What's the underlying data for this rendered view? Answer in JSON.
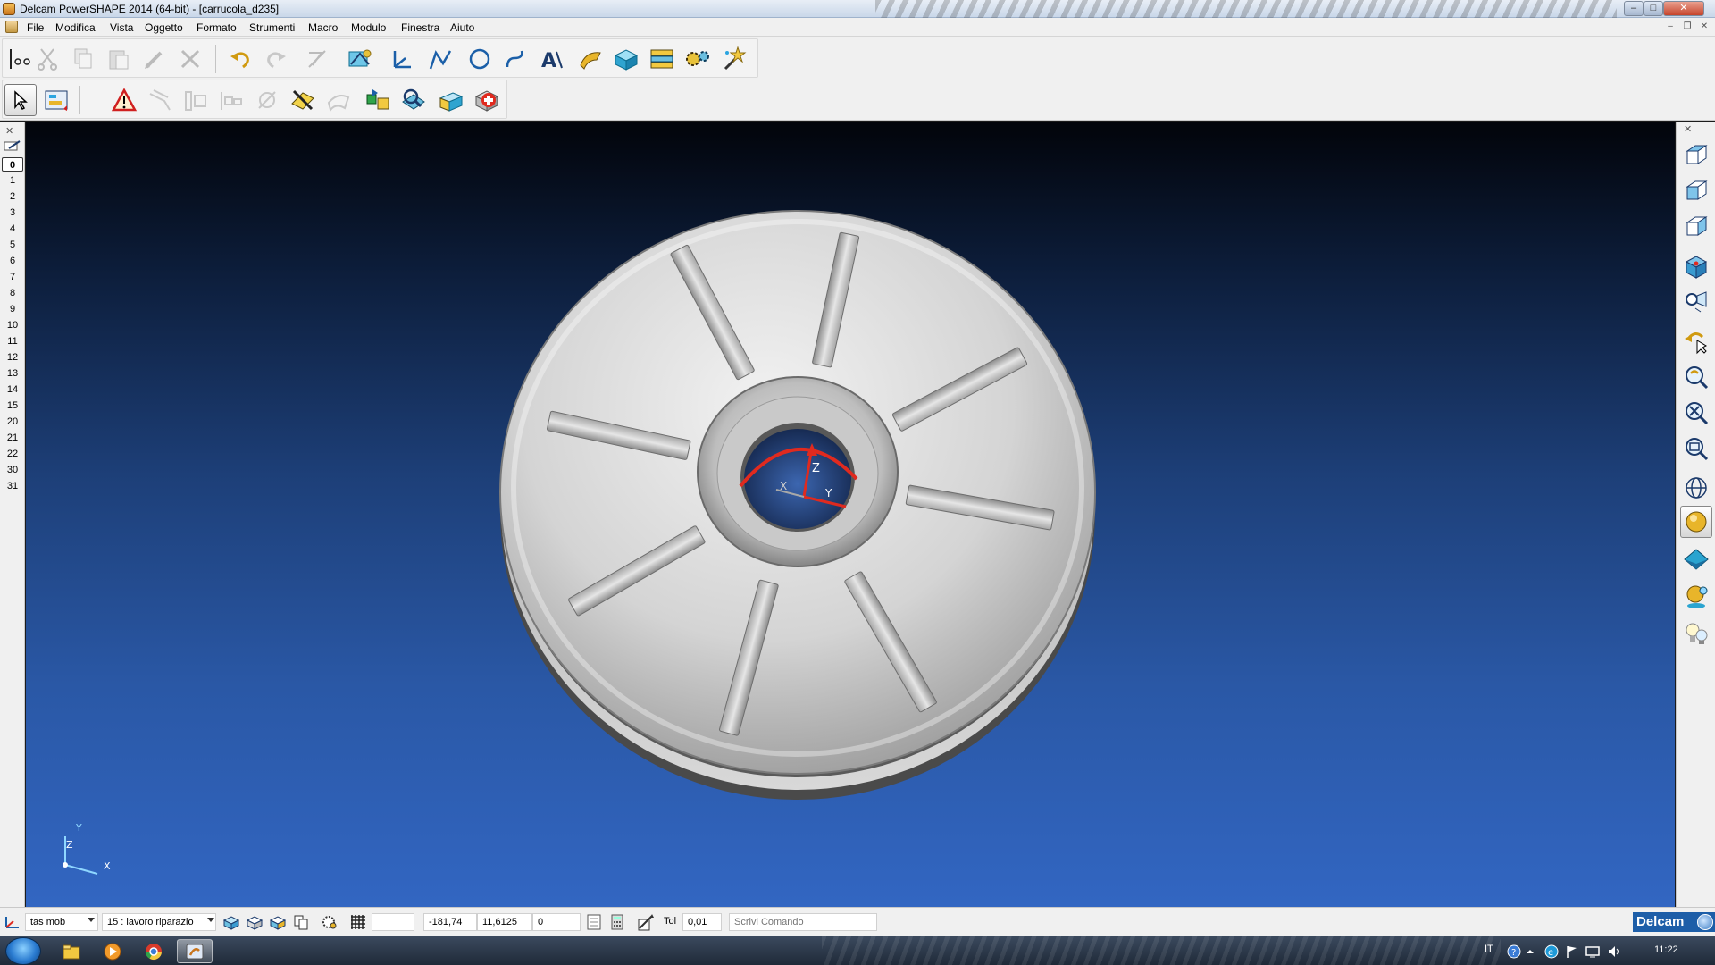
{
  "window": {
    "title": "Delcam PowerSHAPE 2014 (64-bit) - [carrucola_d235]"
  },
  "menu": [
    {
      "label": "File",
      "name": "menu-file"
    },
    {
      "label": "Modifica",
      "name": "menu-modifica"
    },
    {
      "label": "Vista",
      "name": "menu-vista"
    },
    {
      "label": "Oggetto",
      "name": "menu-oggetto"
    },
    {
      "label": "Formato",
      "name": "menu-formato"
    },
    {
      "label": "Strumenti",
      "name": "menu-strumenti"
    },
    {
      "label": "Macro",
      "name": "menu-macro"
    },
    {
      "label": "Modulo",
      "name": "menu-modulo"
    },
    {
      "label": "Finestra",
      "name": "menu-finestra"
    },
    {
      "label": "Aiuto",
      "name": "menu-aiuto"
    }
  ],
  "levels": {
    "current": "0",
    "items": [
      "1",
      "2",
      "3",
      "4",
      "5",
      "6",
      "7",
      "8",
      "9",
      "10",
      "11",
      "12",
      "13",
      "14",
      "15",
      "20",
      "21",
      "22",
      "30",
      "31"
    ]
  },
  "viewport": {
    "workplane_axes": {
      "z": "Z",
      "x": "X",
      "y": "Y"
    },
    "view_triad": {
      "x": "X",
      "y": "Y",
      "z": "Z"
    }
  },
  "status": {
    "workplane": "tas mob",
    "level_select": "15 : lavoro riparazio",
    "x": "-181,74",
    "y": "11,6125",
    "z": "0",
    "tol_label": "Tol",
    "tol_value": "0,01",
    "command_placeholder": "Scrivi Comando"
  },
  "brand": "Delcam",
  "taskbar": {
    "lang": "IT",
    "clock": "11:22"
  },
  "colors": {
    "accent": "#1d5ea8",
    "viewport_top": "#02040a",
    "viewport_bottom": "#3266c2",
    "axis": "#e02a1f"
  }
}
